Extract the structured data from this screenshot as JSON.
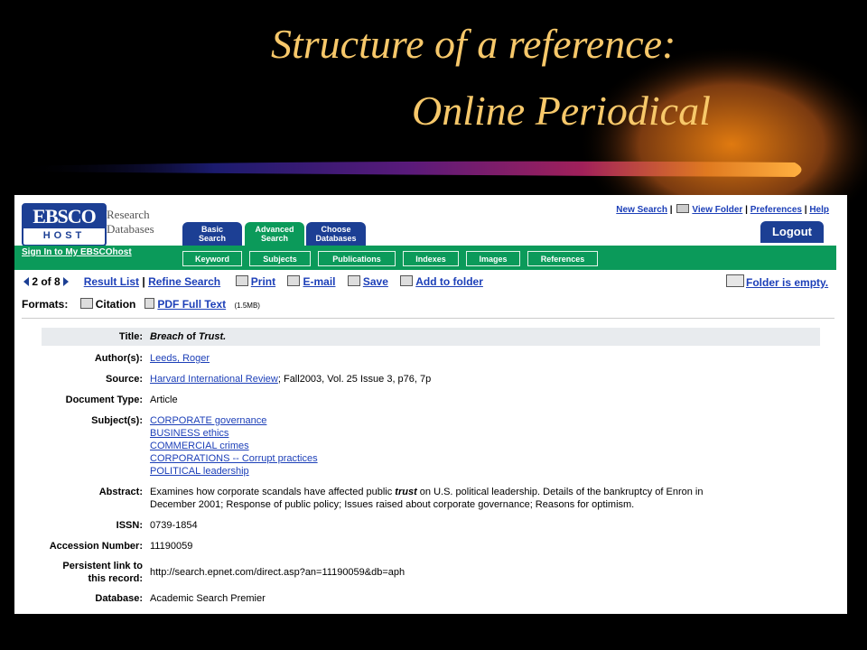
{
  "slide": {
    "title_line1": "Structure of a reference:",
    "title_line2": "Online Periodical",
    "title_color": "#f7c86a"
  },
  "ebsco": {
    "logo_top": "EBSCO",
    "logo_bottom": "HOST",
    "brand_text": [
      "Research",
      "Databases"
    ],
    "tabs": [
      {
        "line1": "Basic",
        "line2": "Search"
      },
      {
        "line1": "Advanced",
        "line2": "Search"
      },
      {
        "line1": "Choose",
        "line2": "Databases"
      }
    ],
    "top_links": {
      "new_search": "New Search",
      "view_folder": "View Folder",
      "preferences": "Preferences",
      "help": "Help",
      "separator": "|"
    },
    "logout": "Logout",
    "signin": "Sign In to My EBSCOhost",
    "subtabs": [
      "Keyword",
      "Subjects",
      "Publications",
      "Indexes",
      "Images",
      "References"
    ],
    "nav": {
      "position": "2 of 8",
      "result_list": "Result List",
      "refine_search": "Refine Search",
      "print": "Print",
      "email": "E-mail",
      "save": "Save",
      "add_to_folder": "Add to folder"
    },
    "folder_empty": "Folder is empty.",
    "formats": {
      "label": "Formats:",
      "citation": "Citation",
      "pdf": "PDF Full Text",
      "pdf_size": "(1.5MB)"
    },
    "colors": {
      "brand_blue": "#1c3f94",
      "green": "#0b9a5a",
      "link": "#1c3fb8"
    }
  },
  "record": {
    "title_label": "Title:",
    "title_parts": [
      "Breach",
      "of",
      "Trust."
    ],
    "author_label": "Author(s):",
    "author": "Leeds, Roger",
    "source_label": "Source:",
    "source_link": "Harvard International Review",
    "source_rest": "; Fall2003, Vol. 25 Issue 3, p76, 7p",
    "doctype_label": "Document Type:",
    "doctype": "Article",
    "subjects_label": "Subject(s):",
    "subjects": [
      "CORPORATE governance",
      "BUSINESS ethics",
      "COMMERCIAL crimes",
      "CORPORATIONS -- Corrupt practices",
      "POLITICAL leadership"
    ],
    "abstract_label": "Abstract:",
    "abstract_before": "Examines how corporate scandals have affected public ",
    "abstract_emph": "trust",
    "abstract_line1_after": " on U.S. political leadership. Details of the bankruptcy of Enron in",
    "abstract_line2": "December 2001; Response of public policy; Issues raised about corporate governance; Reasons for optimism.",
    "issn_label": "ISSN:",
    "issn": "0739-1854",
    "accession_label": "Accession Number:",
    "accession": "11190059",
    "persistent_label_1": "Persistent link to",
    "persistent_label_2": "this record:",
    "persistent_link": "http://search.epnet.com/direct.asp?an=11190059&db=aph",
    "database_label": "Database:",
    "database": "Academic Search Premier"
  }
}
